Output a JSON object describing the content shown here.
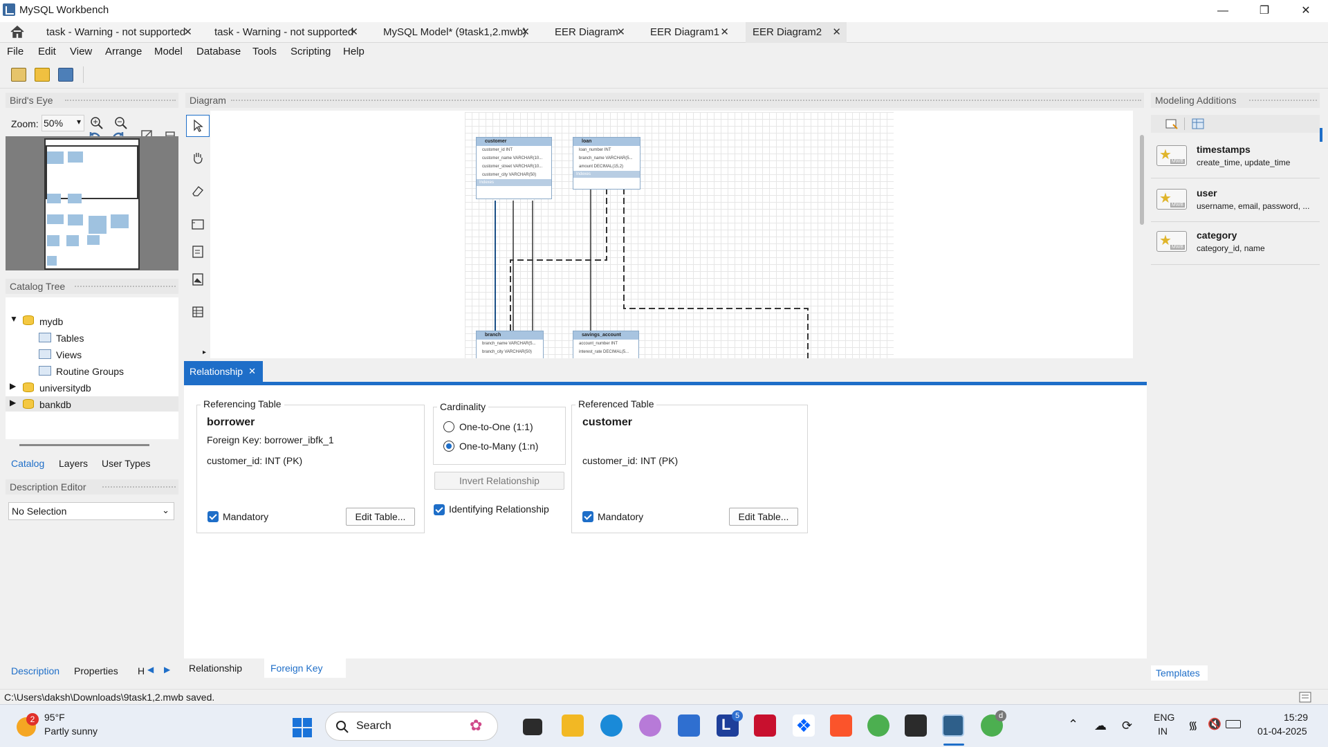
{
  "window": {
    "title": "MySQL Workbench",
    "minimize": "—",
    "maximize": "❐",
    "close": "✕"
  },
  "tabs": [
    {
      "label": "task - Warning - not supported"
    },
    {
      "label": "task - Warning - not supported"
    },
    {
      "label": "MySQL Model* (9task1,2.mwb)"
    },
    {
      "label": "EER Diagram"
    },
    {
      "label": "EER Diagram1"
    },
    {
      "label": "EER Diagram2"
    }
  ],
  "menu": [
    "File",
    "Edit",
    "View",
    "Arrange",
    "Model",
    "Database",
    "Tools",
    "Scripting",
    "Help"
  ],
  "left": {
    "birdseye_title": "Bird's Eye",
    "zoom_label": "Zoom:",
    "zoom_value": "50%",
    "catalog_title": "Catalog Tree",
    "tree": {
      "mydb": "mydb",
      "tables": "Tables",
      "views": "Views",
      "routine_groups": "Routine Groups",
      "universitydb": "universitydb",
      "bankdb": "bankdb"
    },
    "tabs": [
      "Catalog",
      "Layers",
      "User Types"
    ],
    "description_title": "Description Editor",
    "description_select": "No Selection",
    "bottom_tabs": [
      "Description",
      "Properties",
      "H"
    ]
  },
  "diagram": {
    "title": "Diagram",
    "entities": {
      "customer": {
        "name": "customer",
        "rows": [
          "customer_id INT",
          "customer_name VARCHAR(10...",
          "customer_street VARCHAR(10...",
          "customer_city VARCHAR(50)"
        ],
        "footer": "Indexes"
      },
      "loan": {
        "name": "loan",
        "rows": [
          "loan_number INT",
          "branch_name VARCHAR(5...",
          "amount DECIMAL(15,2)"
        ],
        "footer": "Indexes"
      },
      "branch": {
        "name": "branch",
        "rows": [
          "branch_name VARCHAR(5...",
          "branch_city VARCHAR(50)"
        ]
      },
      "savings": {
        "name": "savings_account",
        "rows": [
          "account_number INT",
          "interest_rate DECIMAL(5..."
        ]
      }
    }
  },
  "relationship": {
    "tab_label": "Relationship",
    "tab_close": "✕",
    "referencing": {
      "group_label": "Referencing Table",
      "table": "borrower",
      "fk": "Foreign Key: borrower_ibfk_1",
      "column": "customer_id: INT (PK)",
      "mandatory": "Mandatory",
      "edit": "Edit Table..."
    },
    "cardinality": {
      "group_label": "Cardinality",
      "one_to_one": "One-to-One (1:1)",
      "one_to_many": "One-to-Many (1:n)",
      "invert": "Invert Relationship",
      "identifying": "Identifying Relationship"
    },
    "referenced": {
      "group_label": "Referenced Table",
      "table": "customer",
      "column": "customer_id: INT (PK)",
      "mandatory": "Mandatory",
      "edit": "Edit Table..."
    },
    "bottom_tabs": [
      "Relationship",
      "Foreign Key"
    ]
  },
  "right": {
    "title": "Modeling Additions",
    "snippets": [
      {
        "title": "timestamps",
        "desc": "create_time, update_time"
      },
      {
        "title": "user",
        "desc": "username, email, password, ..."
      },
      {
        "title": "category",
        "desc": "category_id, name"
      }
    ],
    "mwb_badge": "MWB",
    "templates_tab": "Templates"
  },
  "status": "C:\\Users\\daksh\\Downloads\\9task1,2.mwb saved.",
  "taskbar": {
    "weather_temp": "95°F",
    "weather_desc": "Partly sunny",
    "weather_badge": "2",
    "search": "Search",
    "lang1": "ENG",
    "lang2": "IN",
    "time": "15:29",
    "date": "01-04-2025",
    "l_badge": "5",
    "l_letter": "L",
    "chrome_badge": "d"
  },
  "colors": {
    "accent": "#1e6ec8",
    "entity_header": "#a8c4e0"
  }
}
